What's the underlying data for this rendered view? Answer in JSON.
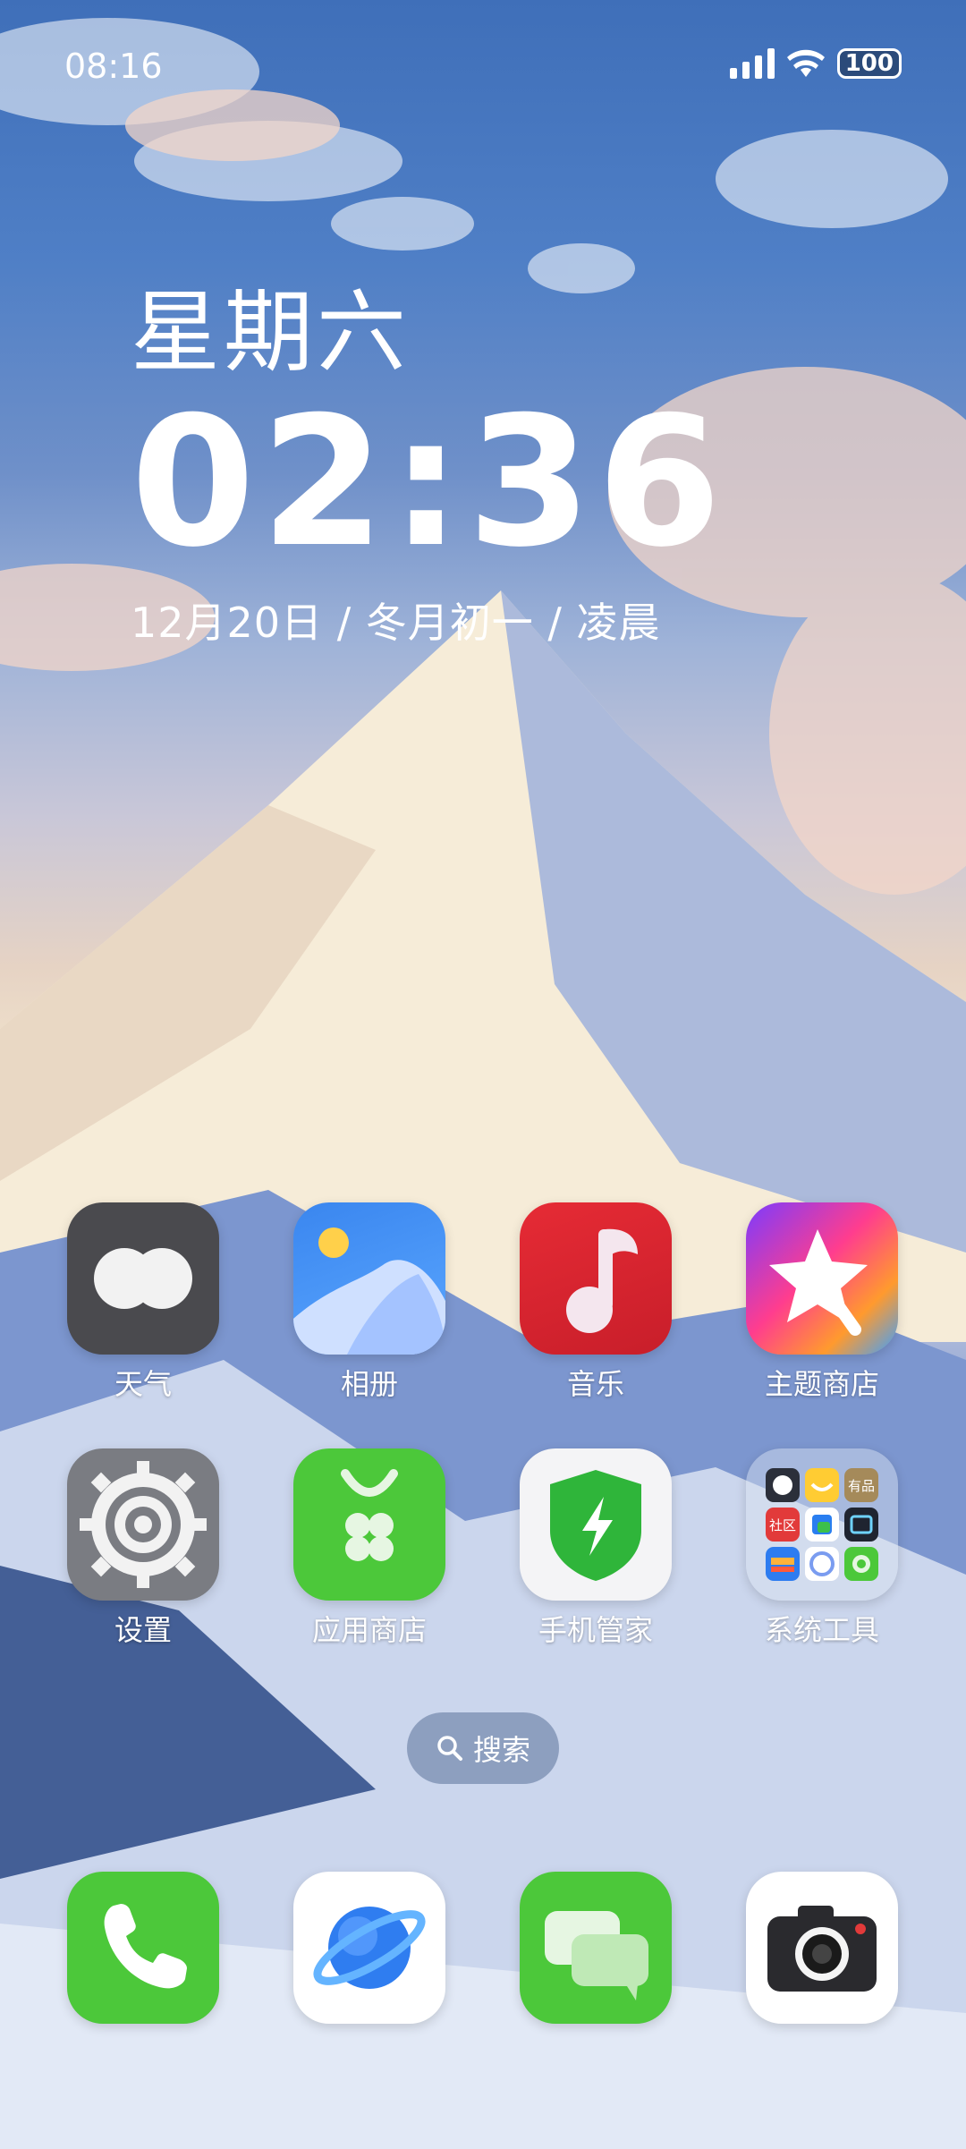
{
  "status_bar": {
    "time": "08:16",
    "battery": "100"
  },
  "clock": {
    "weekday": "星期六",
    "time": "02:36",
    "date_line": "12月20日 / 冬月初一  / 凌晨"
  },
  "apps": [
    {
      "label": "天气",
      "icon": "weather-icon"
    },
    {
      "label": "相册",
      "icon": "gallery-icon"
    },
    {
      "label": "音乐",
      "icon": "music-icon"
    },
    {
      "label": "主题商店",
      "icon": "theme-store-icon"
    },
    {
      "label": "设置",
      "icon": "settings-gear-icon"
    },
    {
      "label": "应用商店",
      "icon": "app-store-icon"
    },
    {
      "label": "手机管家",
      "icon": "security-shield-icon"
    },
    {
      "label": "系统工具",
      "icon": "folder-icon"
    }
  ],
  "folder_mini_labels": {
    "youpin": "有品",
    "community": "社区"
  },
  "search": {
    "label": "搜索"
  },
  "dock": [
    {
      "icon": "phone-icon"
    },
    {
      "icon": "browser-icon"
    },
    {
      "icon": "messages-icon"
    },
    {
      "icon": "camera-icon"
    }
  ],
  "colors": {
    "weather": "#4a4a4e",
    "gallery": "#3d8cf0",
    "music": "#e0303a",
    "settings": "#7a7c82",
    "appstore": "#4cc83a",
    "shield": "#2fb53a",
    "phone": "#4cc83a",
    "messages": "#4cc83a"
  }
}
